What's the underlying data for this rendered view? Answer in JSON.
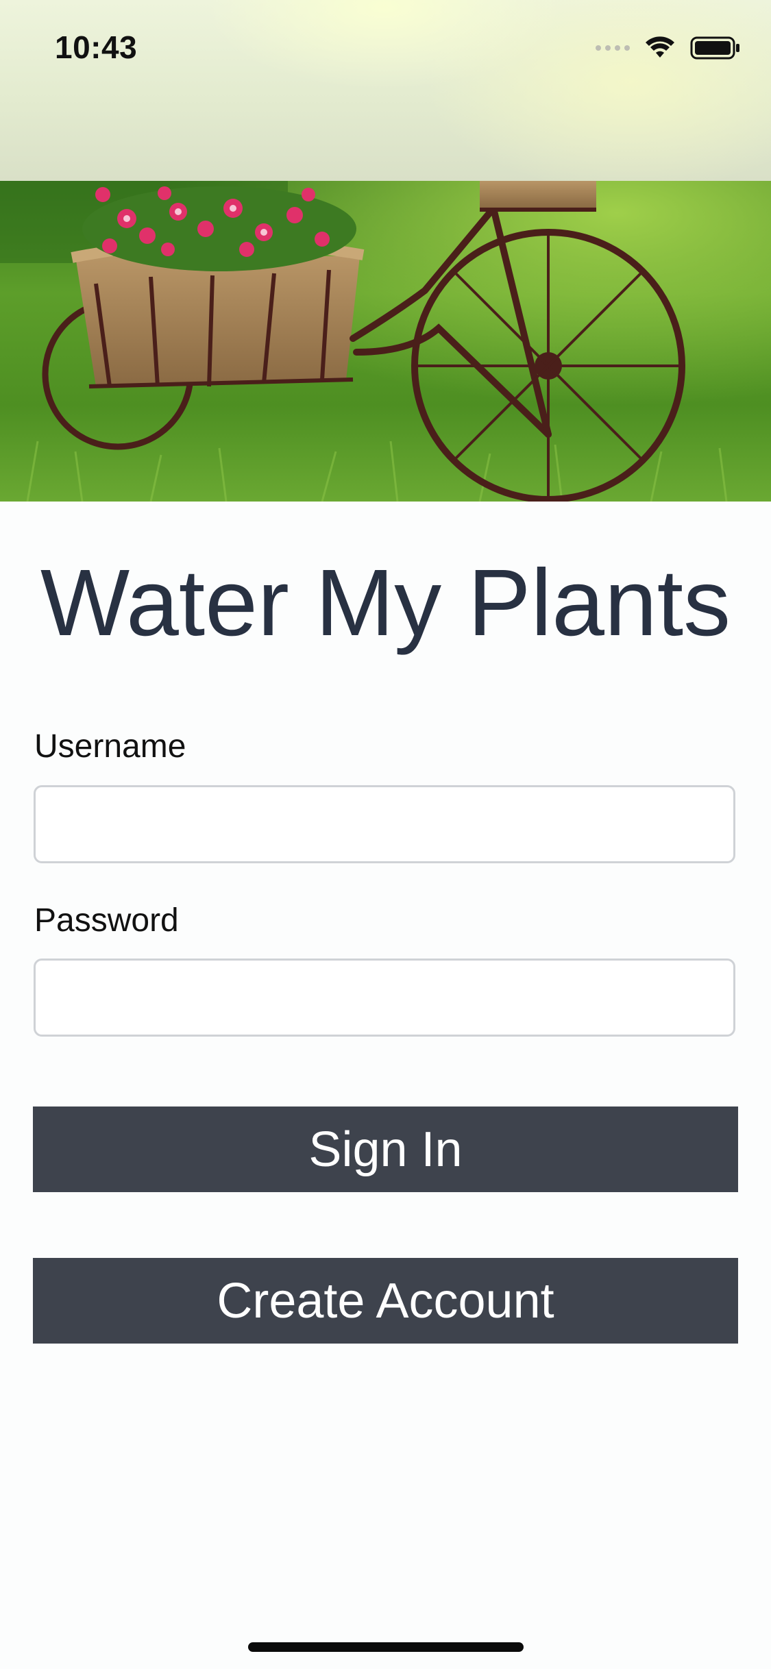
{
  "status_bar": {
    "time": "10:43",
    "icons": [
      "cellular-signal-icon",
      "wifi-icon",
      "battery-icon"
    ]
  },
  "hero": {
    "description_icon": "flower-bicycle-planter-image"
  },
  "app": {
    "title": "Water My Plants"
  },
  "form": {
    "username_label": "Username",
    "username_value": "",
    "password_label": "Password",
    "password_value": ""
  },
  "buttons": {
    "sign_in": "Sign In",
    "create_account": "Create Account"
  },
  "colors": {
    "title_text": "#283142",
    "button_bg": "#3e434d",
    "button_text": "#ffffff",
    "input_border": "#cfd2d6",
    "background": "#fcfdfd"
  }
}
